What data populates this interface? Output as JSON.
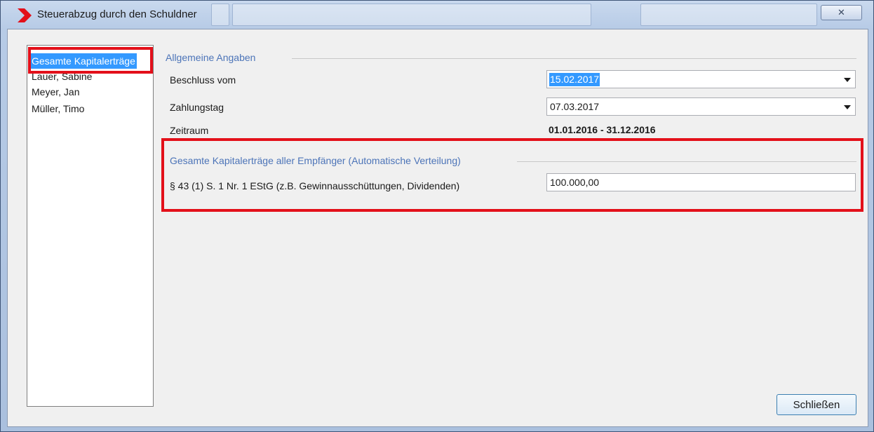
{
  "window": {
    "title": "Steuerabzug durch den Schuldner",
    "close_glyph": "✕"
  },
  "sidebar": {
    "items": [
      {
        "label": "Gesamte Kapitalerträge",
        "selected": true
      },
      {
        "label": "Lauer, Sabine"
      },
      {
        "label": "Meyer, Jan"
      },
      {
        "label": "Müller, Timo"
      }
    ]
  },
  "general": {
    "title": "Allgemeine Angaben",
    "beschluss_label": "Beschluss vom",
    "beschluss_value": "15.02.2017",
    "zahlungstag_label": "Zahlungstag",
    "zahlungstag_value": "07.03.2017",
    "zeitraum_label": "Zeitraum",
    "zeitraum_value": "01.01.2016 - 31.12.2016"
  },
  "kapital": {
    "title": "Gesamte Kapitalerträge aller Empfänger (Automatische Verteilung)",
    "row_label": "§ 43 (1) S. 1 Nr. 1 EStG (z.B. Gewinnausschüttungen, Dividenden)",
    "row_value": "100.000,00"
  },
  "footer": {
    "close_label": "Schließen"
  },
  "colors": {
    "highlight": "#e3101a",
    "selection": "#3399ff",
    "group_title": "#4c74b8",
    "logo": "#e3101a"
  },
  "icons": {
    "app_logo": "red-chevron-icon",
    "close": "close-icon",
    "dropdown": "chevron-down-icon"
  }
}
